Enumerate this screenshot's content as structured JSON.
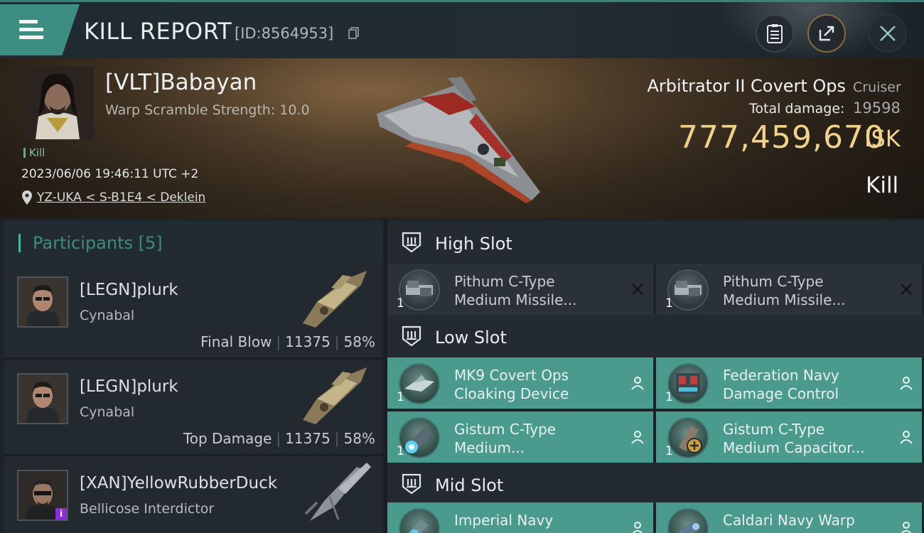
{
  "header": {
    "title": "KILL REPORT",
    "report_id": "[ID:8564953]"
  },
  "victim": {
    "name": "[VLT]Babayan",
    "warp_scramble": "Warp Scramble Strength: 10.0",
    "tag": "Kill",
    "datetime": "2023/06/06 19:46:11 UTC +2",
    "location": "YZ-UKA < S-B1E4 < Deklein",
    "ship_name": "Arbitrator II Covert Ops",
    "ship_class": "Cruiser",
    "total_damage_label": "Total damage:",
    "total_damage": "19598",
    "isk_value": "777,459,670",
    "isk_unit": "ISK",
    "result": "Kill"
  },
  "participants": {
    "title": "Participants",
    "count": "[5]",
    "rows": [
      {
        "name": "[LEGN]plurk",
        "ship": "Cynabal",
        "role": "Final Blow",
        "damage": "11375",
        "percent": "58%"
      },
      {
        "name": "[LEGN]plurk",
        "ship": "Cynabal",
        "role": "Top Damage",
        "damage": "11375",
        "percent": "58%"
      },
      {
        "name": "[XAN]YellowRubberDuck",
        "ship": "Bellicose Interdictor",
        "badge": "i"
      }
    ]
  },
  "slots": {
    "high": {
      "title": "High Slot",
      "modules": [
        {
          "line1": "Pithum C-Type",
          "line2": "Medium Missile...",
          "qty": "1",
          "status": "destroyed"
        },
        {
          "line1": "Pithum C-Type",
          "line2": "Medium Missile...",
          "qty": "1",
          "status": "destroyed"
        }
      ]
    },
    "low": {
      "title": "Low Slot",
      "modules": [
        {
          "line1": "MK9 Covert Ops",
          "line2": "Cloaking Device",
          "qty": "1",
          "status": "dropped"
        },
        {
          "line1": "Federation Navy",
          "line2": "Damage Control",
          "qty": "1",
          "status": "dropped"
        },
        {
          "line1": "Gistum C-Type",
          "line2": "Medium...",
          "qty": "1",
          "status": "dropped"
        },
        {
          "line1": "Gistum C-Type",
          "line2": "Medium Capacitor...",
          "qty": "1",
          "status": "dropped"
        }
      ]
    },
    "mid": {
      "title": "Mid Slot",
      "modules": [
        {
          "line1": "Imperial Navy",
          "line2": "",
          "qty": "1",
          "status": "dropped"
        },
        {
          "line1": "Caldari Navy Warp",
          "line2": "",
          "qty": "1",
          "status": "dropped"
        }
      ]
    }
  },
  "colors": {
    "accent": "#4fb3a2",
    "dropped_bg": "#4b9a8e",
    "isk": "#f0d28c"
  }
}
